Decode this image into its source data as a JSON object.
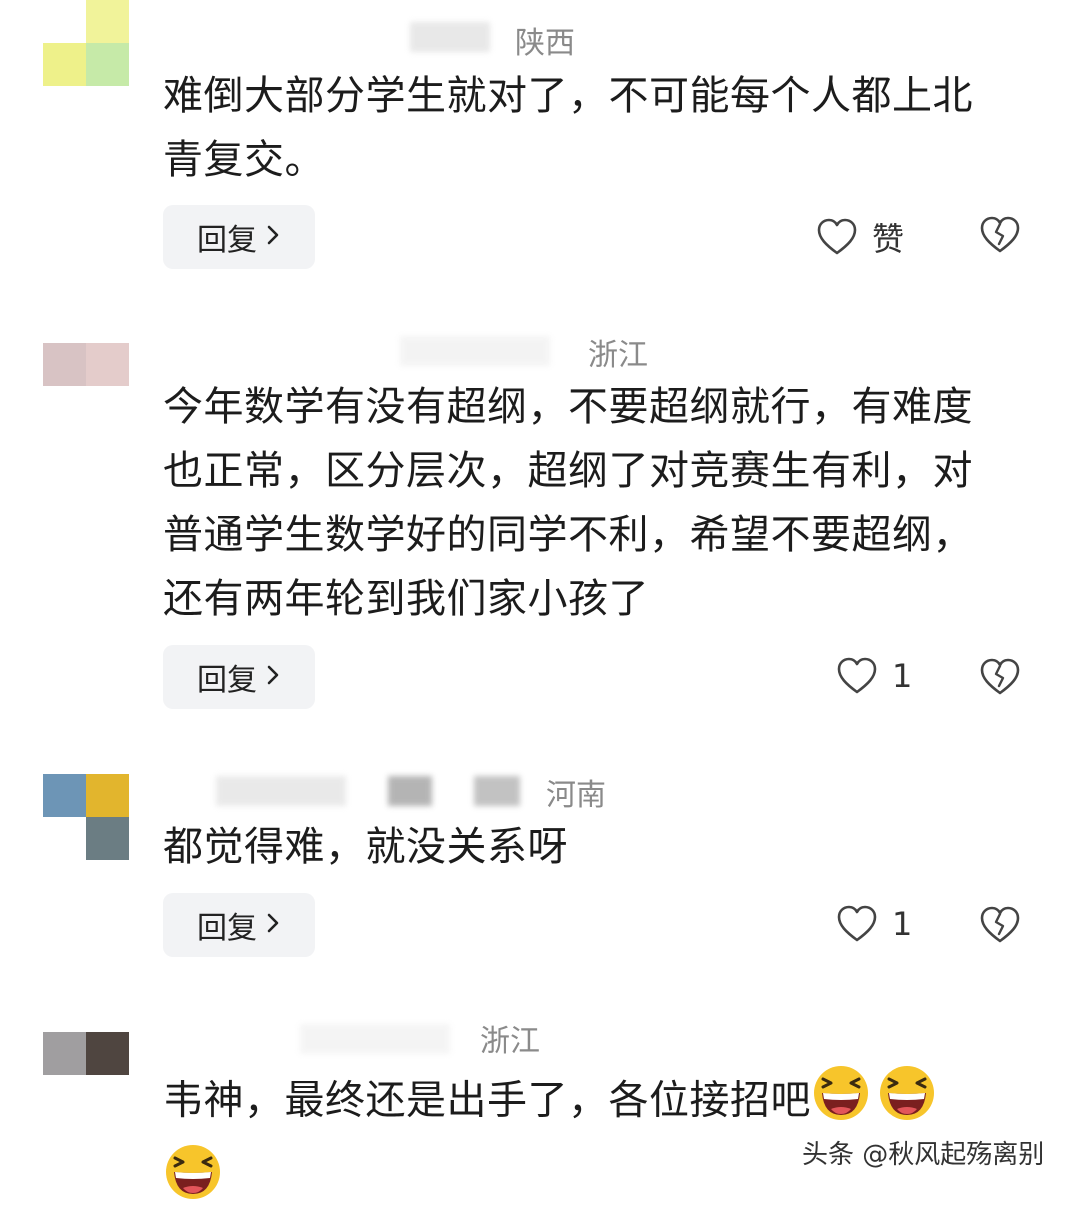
{
  "comments": [
    {
      "location": "陕西",
      "text": "难倒大部分学生就对了，不可能每个人都上北青复交。",
      "reply_label": "回复",
      "like_label": "赞"
    },
    {
      "location": "浙江",
      "text": "今年数学有没有超纲，不要超纲就行，有难度也正常，区分层次，超纲了对竞赛生有利，对普通学生数学好的同学不利，希望不要超纲，还有两年轮到我们家小孩了",
      "reply_label": "回复",
      "like_label": "1"
    },
    {
      "location": "河南",
      "text": "都觉得难，就没关系呀",
      "reply_label": "回复",
      "like_label": "1"
    },
    {
      "location": "浙江",
      "text": "韦神，最终还是出手了，各位接招吧",
      "emoji_name": "laughing-emoji"
    }
  ],
  "watermark": "头条 @秋风起殇离别",
  "colors": {
    "reply_bg": "#f2f3f5",
    "location": "#8a8a8a",
    "emoji_face": "#f7c52b"
  }
}
